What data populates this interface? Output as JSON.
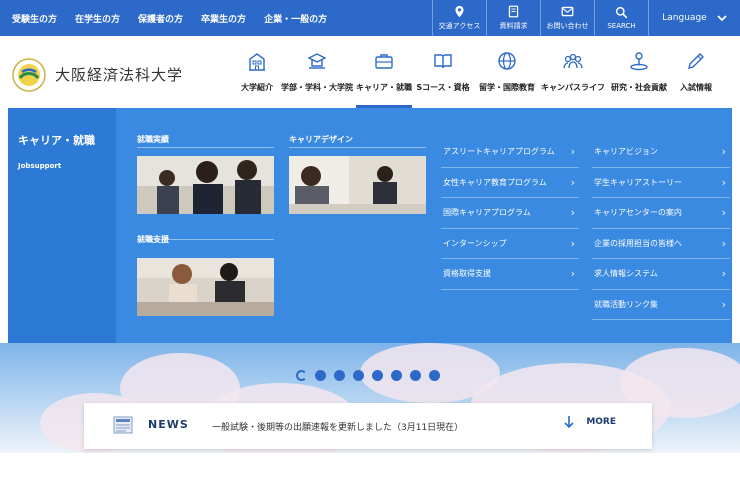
{
  "topbar": {
    "nav": [
      "受験生の方",
      "在学生の方",
      "保護者の方",
      "卒業生の方",
      "企業・一般の方"
    ],
    "util": [
      {
        "icon": "map-pin-icon",
        "label": "交通アクセス"
      },
      {
        "icon": "document-icon",
        "label": "資料請求"
      },
      {
        "icon": "mail-icon",
        "label": "お問い合わせ"
      },
      {
        "icon": "search-icon",
        "label": "SEARCH"
      }
    ],
    "language": "Language"
  },
  "header": {
    "university_name": "大阪経済法科大学",
    "nav": [
      {
        "icon": "building-icon",
        "label": "大学紹介"
      },
      {
        "icon": "faculty-icon",
        "label": "学部・学科・大学院"
      },
      {
        "icon": "briefcase-icon",
        "label": "キャリア・就職",
        "active": true
      },
      {
        "icon": "book-icon",
        "label": "Sコース・資格"
      },
      {
        "icon": "globe-icon",
        "label": "留学・国際教育"
      },
      {
        "icon": "people-icon",
        "label": "キャンパスライフ"
      },
      {
        "icon": "research-icon",
        "label": "研究・社会貢献"
      },
      {
        "icon": "pen-icon",
        "label": "入試情報"
      }
    ]
  },
  "mega_menu": {
    "title": "キャリア・就職",
    "subtitle": "Jobsupport",
    "sections": [
      {
        "label": "就職実績"
      },
      {
        "label": "キャリアデザイン"
      },
      {
        "label": "就職支援"
      }
    ],
    "links_col1": [
      "アスリートキャリアプログラム",
      "女性キャリア教育プログラム",
      "国際キャリアプログラム",
      "インターンシップ",
      "資格取得支援"
    ],
    "links_col2": [
      "キャリアビジョン",
      "学生キャリアストーリー",
      "キャリアセンターの案内",
      "企業の採用担当の皆様へ",
      "求人情報システム",
      "就職活動リンク集"
    ]
  },
  "news": {
    "label": "NEWS",
    "text": "一般試験・後期等の出願速報を更新しました（3月11日現在）",
    "more": "MORE"
  },
  "colors": {
    "primary": "#2d69c9",
    "mega_bg": "#3b8ae2",
    "navy": "#1e3b6e"
  }
}
